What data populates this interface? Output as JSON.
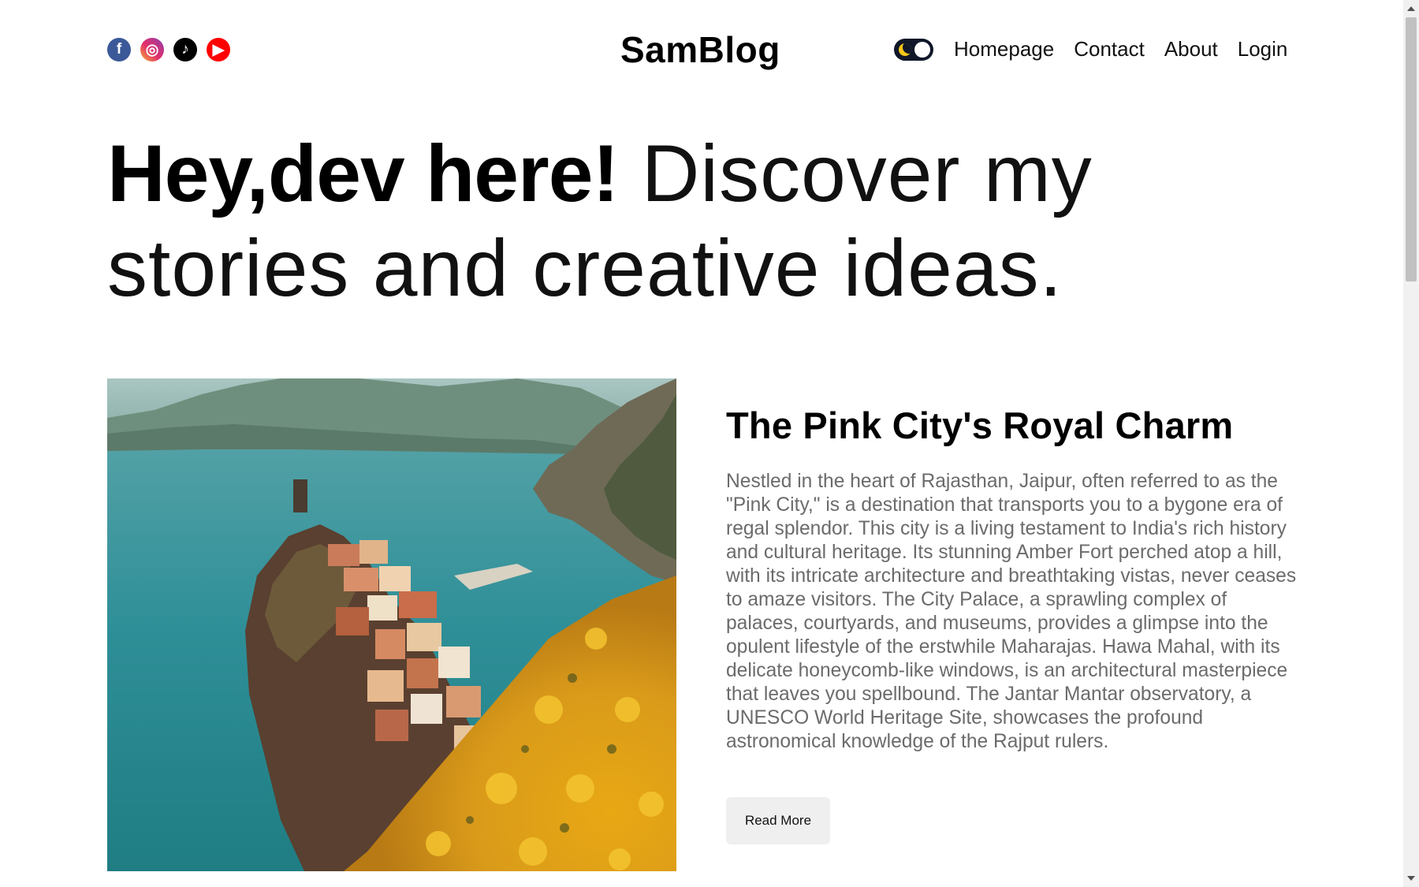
{
  "header": {
    "social": [
      {
        "name": "facebook-icon",
        "glyph": "f"
      },
      {
        "name": "instagram-icon",
        "glyph": "◎"
      },
      {
        "name": "tiktok-icon",
        "glyph": "♪"
      },
      {
        "name": "youtube-icon",
        "glyph": "▶"
      }
    ],
    "logo": "SamBlog",
    "nav": {
      "homepage": "Homepage",
      "contact": "Contact",
      "about": "About",
      "login": "Login"
    },
    "theme_toggle": {
      "icon": "moon-icon",
      "mode": "dark"
    }
  },
  "hero": {
    "bold": "Hey,dev here!",
    "light": " Discover my stories and creative ideas."
  },
  "post": {
    "title": "The Pink City's Royal Charm",
    "body": "Nestled in the heart of Rajasthan, Jaipur, often referred to as the \"Pink City,\" is a destination that transports you to a bygone era of regal splendor. This city is a living testament to India's rich history and cultural heritage. Its stunning Amber Fort perched atop a hill, with its intricate architecture and breathtaking vistas, never ceases to amaze visitors. The City Palace, a sprawling complex of palaces, courtyards, and museums, provides a glimpse into the opulent lifestyle of the erstwhile Maharajas. Hawa Mahal, with its delicate honeycomb-like windows, is an architectural masterpiece that leaves you spellbound. The Jantar Mantar observatory, a UNESCO World Heritage Site, showcases the profound astronomical knowledge of the Rajput rulers.",
    "button": "Read More"
  },
  "colors": {
    "text": "#000000",
    "body_text": "#6b6b6b",
    "button_bg": "#efefef",
    "toggle_bg": "#0f1729",
    "moon": "#f5c518"
  }
}
